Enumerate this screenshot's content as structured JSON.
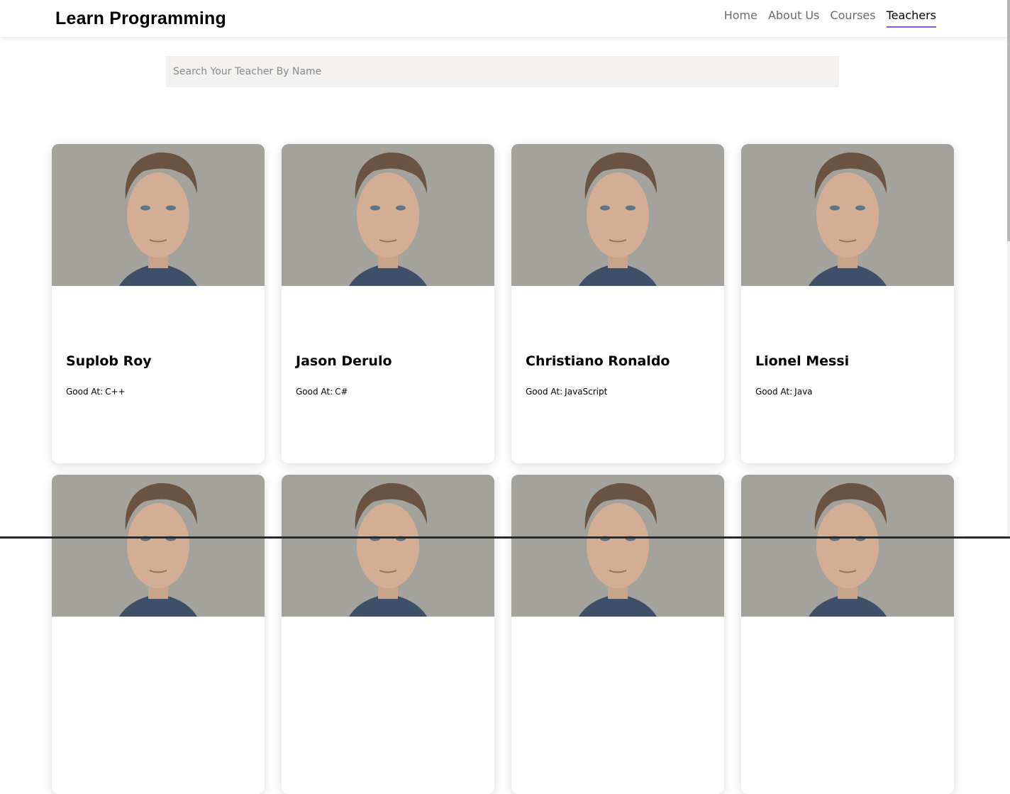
{
  "brand": "Learn Programming",
  "nav": {
    "items": [
      {
        "label": "Home"
      },
      {
        "label": "About Us"
      },
      {
        "label": "Courses"
      },
      {
        "label": "Teachers"
      }
    ],
    "active": "Teachers",
    "accent_color": "#7b5cff"
  },
  "search": {
    "placeholder": "Search Your Teacher By Name",
    "value": ""
  },
  "teachers": {
    "skill_label": "Good At:",
    "cards": [
      {
        "name": "Suplob Roy",
        "skill": "C++"
      },
      {
        "name": "Jason Derulo",
        "skill": "C#"
      },
      {
        "name": "Christiano Ronaldo",
        "skill": "JavaScript"
      },
      {
        "name": "Lionel Messi",
        "skill": "Java"
      },
      {
        "name": "",
        "skill": ""
      },
      {
        "name": "",
        "skill": ""
      },
      {
        "name": "",
        "skill": ""
      },
      {
        "name": "",
        "skill": ""
      }
    ]
  }
}
